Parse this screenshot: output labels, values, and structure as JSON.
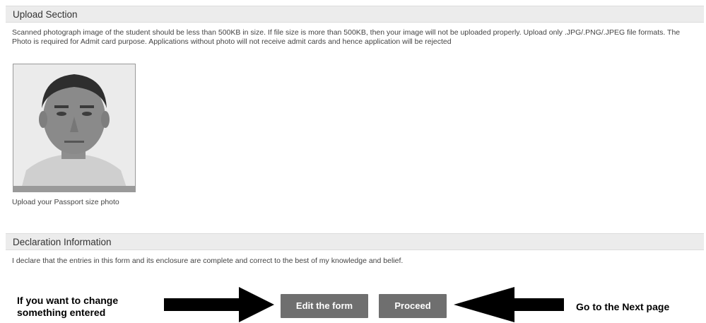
{
  "upload_section": {
    "title": "Upload Section",
    "description": "Scanned photograph image of the student should be less than 500KB in size. If file size is more than 500KB, then your image will not be uploaded properly. Upload only .JPG/.PNG/.JPEG file formats. The Photo is required for Admit card purpose. Applications without photo will not receive admit cards and hence application will be rejected",
    "photo_caption": "Upload your Passport size photo"
  },
  "declaration_section": {
    "title": "Declaration Information",
    "text": "I declare that the entries in this form and its enclosure are complete and correct to the best of my knowledge and belief."
  },
  "actions": {
    "edit_label": "Edit the form",
    "proceed_label": "Proceed"
  },
  "annotations": {
    "left_text": "If you want to change something entered",
    "right_text": "Go to the Next page"
  },
  "icons": {
    "left_arrow": "right-pointing-arrow-icon",
    "right_arrow": "left-pointing-arrow-icon"
  },
  "colors": {
    "button_bg": "#6f6f6f",
    "header_bg": "#ececec"
  }
}
